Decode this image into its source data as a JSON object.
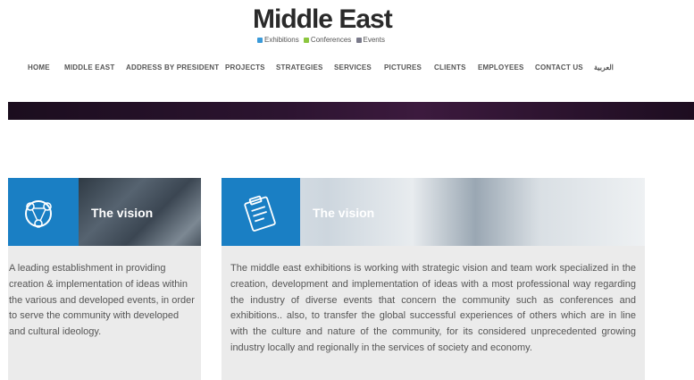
{
  "logo": {
    "title": "Middle East",
    "tags": [
      {
        "label": "Exhibitions",
        "color": "#3a9ad9"
      },
      {
        "label": "Conferences",
        "color": "#8cc63f"
      },
      {
        "label": "Events",
        "color": "#7a7a8a"
      }
    ]
  },
  "nav": {
    "items": [
      "HOME",
      "MIDDLE EAST",
      "ADDRESS BY PRESIDENT",
      "PROJECTS",
      "STRATEGIES",
      "SERVICES",
      "PICTURES",
      "CLIENTS",
      "EMPLOYEES",
      "CONTACT US",
      "العربية"
    ]
  },
  "cards": [
    {
      "title": "The vision",
      "icon": "globe-network-icon",
      "text": "A leading establishment in providing creation & implementation of ideas within the various and developed events, in order to serve the community with developed and cultural ideology."
    },
    {
      "title": "The vision",
      "icon": "clipboard-icon",
      "text": "The middle east exhibitions is working with strategic vision and team work specialized in the creation, development and implementation of ideas with a most professional way regarding the industry of diverse events that concern the community such as conferences and exhibitions.. also, to transfer the global successful experiences of others which are in line with the culture and nature of the community, for its considered unprecedented growing industry locally and regionally in the services of society and economy."
    }
  ],
  "colors": {
    "accent_blue": "#1a7fc4",
    "card_bg": "#ebebeb",
    "banner_dark": "#2c1430"
  }
}
